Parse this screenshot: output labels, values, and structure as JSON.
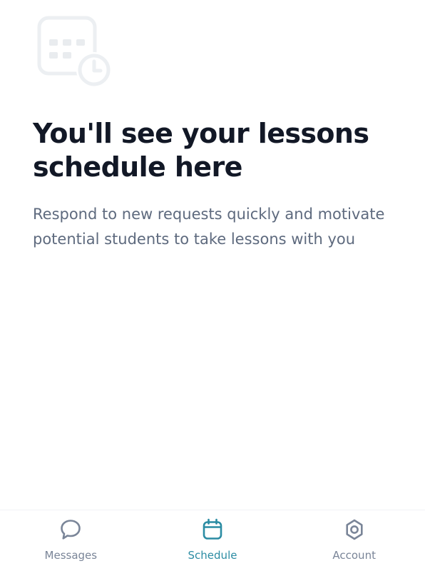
{
  "empty_state": {
    "icon": "calendar-clock-icon",
    "title": "You'll see your lessons schedule here",
    "description": "Respond to new requests quickly and motivate potential students to take lessons with you"
  },
  "tabbar": {
    "active": "Schedule",
    "active_color": "#2b8ca3",
    "inactive_color": "#7a8598",
    "tabs": [
      {
        "label": "Messages",
        "icon": "chat-bubble-icon"
      },
      {
        "label": "Schedule",
        "icon": "calendar-icon"
      },
      {
        "label": "Account",
        "icon": "gear-icon"
      }
    ]
  }
}
